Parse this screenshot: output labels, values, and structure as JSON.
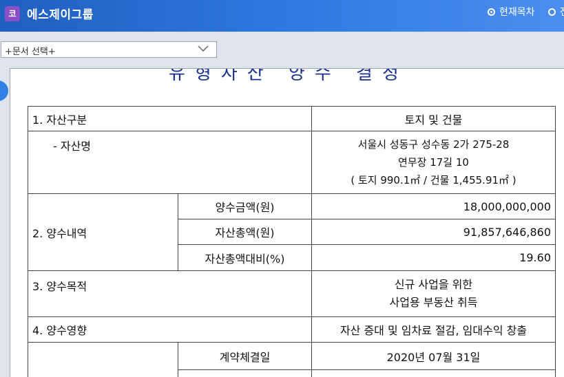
{
  "app": {
    "icon_text": "코",
    "title": "에스제이그룹"
  },
  "toc_options": {
    "current": "현재목차",
    "other": "전"
  },
  "doc_select": {
    "value": "+문서 선택+"
  },
  "doc": {
    "title_partial": "유형자산 양수 결정",
    "rows": {
      "asset_type": {
        "label": "1. 자산구분",
        "value": "토지 및 건물"
      },
      "asset_name": {
        "label": "- 자산명",
        "line1": "서울시 성동구 성수동 2가 275-28",
        "line2": "연무장 17길 10",
        "line3": "( 토지 990.1㎡ / 건물 1,455.91㎡ )"
      },
      "acquisition": {
        "label": "2. 양수내역",
        "amount_label": "양수금액(원)",
        "amount_value": "18,000,000,000",
        "total_label": "자산총액(원)",
        "total_value": "91,857,646,860",
        "ratio_label": "자산총액대비(%)",
        "ratio_value": "19.60"
      },
      "purpose": {
        "label": "3. 양수목적",
        "line1": "신규 사업을 위한",
        "line2": "사업용 부동산 취득"
      },
      "effect": {
        "label": "4. 양수영향",
        "value": "자산 증대 및 임차료 절감, 임대수익 창출"
      },
      "schedule": {
        "contract_label": "계약체결일",
        "contract_value": "2020년 07월 31일"
      }
    }
  },
  "colors": {
    "topbar": "#2f78e0",
    "app_icon": "#8a4fc7",
    "title_text": "#1b2f8f"
  }
}
